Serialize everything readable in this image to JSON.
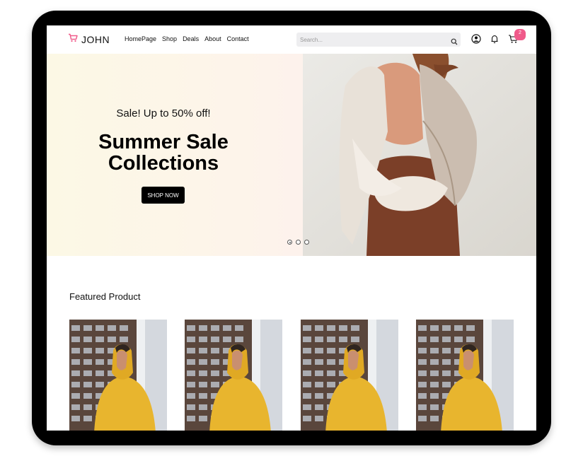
{
  "header": {
    "logo_text": "JOHN",
    "nav": [
      "HomePage",
      "Shop",
      "Deals",
      "About",
      "Contact"
    ],
    "search_placeholder": "Search...",
    "cart_count": "2",
    "icons": [
      "cart-logo-icon",
      "search-icon",
      "user-icon",
      "bell-icon",
      "cart-icon"
    ]
  },
  "hero": {
    "subtitle": "Sale! Up to 50% off!",
    "title_line1": "Summer Sale",
    "title_line2": "Collections",
    "button": "SHOP NOW",
    "slides": 3,
    "active_slide": 1
  },
  "featured": {
    "title": "Featured Product",
    "product_count": 4
  },
  "colors": {
    "accent": "#f05a8a",
    "hero_bg": "#fcf8e5",
    "button_bg": "#000000",
    "product_yellow": "#e8b52e"
  }
}
